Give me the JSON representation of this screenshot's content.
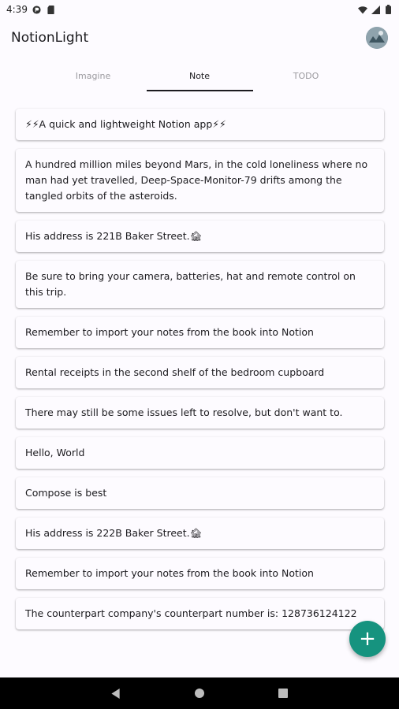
{
  "status_bar": {
    "time": "4:39"
  },
  "app": {
    "title": "NotionLight"
  },
  "tabs": [
    {
      "label": "Imagine",
      "active": false
    },
    {
      "label": "Note",
      "active": true
    },
    {
      "label": "TODO",
      "active": false
    }
  ],
  "notes": [
    "⚡⚡A quick and lightweight Notion app⚡⚡",
    "A hundred million miles beyond Mars, in the cold loneliness where no man had yet travelled, Deep-Space-Monitor-79 drifts among the tangled orbits of the asteroids.",
    "His address is 221B Baker Street.🏚",
    "Be sure to bring your camera, batteries, hat and remote control on this trip.",
    "Remember to import your notes from the book into Notion",
    "Rental receipts in the second shelf of the bedroom cupboard",
    "There may still be some issues left to resolve, but don't want to.",
    "Hello, World",
    "Compose is best",
    "His address is 222B Baker Street.🏚",
    "Remember to import your notes from the book into Notion",
    "The counterpart company's counterpart number is: 128736124122"
  ],
  "fab": {
    "icon": "plus-icon",
    "symbol": "+",
    "color": "#16937f"
  }
}
